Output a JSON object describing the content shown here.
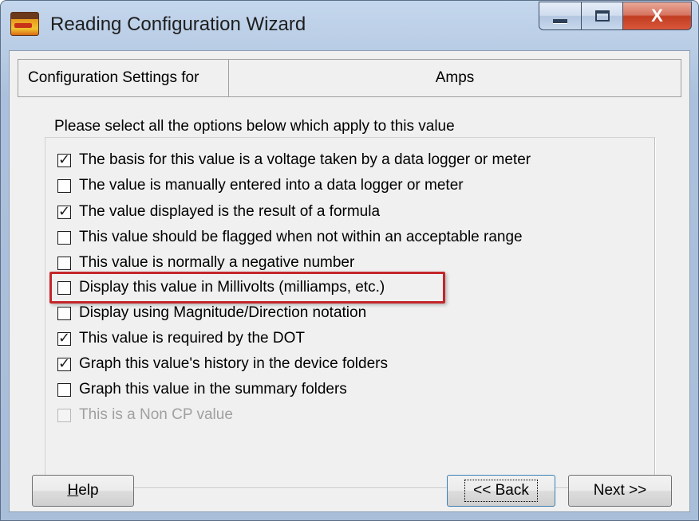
{
  "window": {
    "title": "Reading Configuration Wizard",
    "icon": "app-logo-icon",
    "controls": {
      "minimize": "minimize-icon",
      "maximize": "maximize-icon",
      "close": "X"
    }
  },
  "settings": {
    "label": "Configuration Settings for",
    "value": "Amps"
  },
  "prompt": "Please select all the options below which apply to this value",
  "options": [
    {
      "label": "The basis for this value is a voltage taken by a data logger or meter",
      "checked": true,
      "enabled": true
    },
    {
      "label": "The value is manually entered into a data logger or meter",
      "checked": false,
      "enabled": true
    },
    {
      "label": "The value displayed is the result of a formula",
      "checked": true,
      "enabled": true
    },
    {
      "label": "This value should be flagged when not within an acceptable range",
      "checked": false,
      "enabled": true
    },
    {
      "label": "This value is normally a negative number",
      "checked": false,
      "enabled": true
    },
    {
      "label": "Display this value in Millivolts (milliamps, etc.)",
      "checked": false,
      "enabled": true
    },
    {
      "label": "Display using Magnitude/Direction notation",
      "checked": false,
      "enabled": true
    },
    {
      "label": "This value is required by the DOT",
      "checked": true,
      "enabled": true
    },
    {
      "label": "Graph this value's history in the device folders",
      "checked": true,
      "enabled": true
    },
    {
      "label": "Graph this value in the summary folders",
      "checked": false,
      "enabled": true
    },
    {
      "label": "This is a Non CP value",
      "checked": false,
      "enabled": false
    }
  ],
  "buttons": {
    "help": "Help",
    "back": "<< Back",
    "next": "Next >>"
  },
  "colors": {
    "highlight": "#c4262b",
    "title_bar": "#b7cbe4",
    "dialog_bg": "#f0f0f0"
  }
}
